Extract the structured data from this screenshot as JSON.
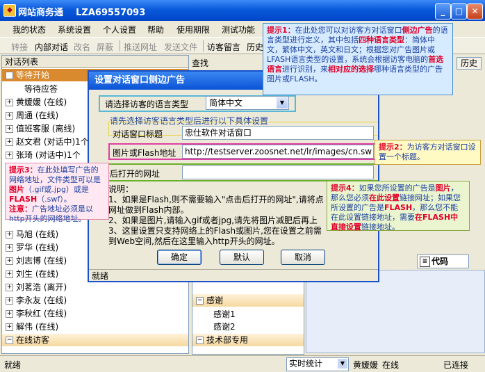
{
  "window": {
    "app_title": "网站商务通",
    "account_id": "LZA69557093"
  },
  "menu": [
    "我的状态",
    "系统设置",
    "个人设置",
    "帮助",
    "使用期限",
    "测试功能"
  ],
  "toolbar": {
    "items": [
      {
        "label": "转接",
        "enabled": false
      },
      {
        "label": "内部对话",
        "enabled": true
      },
      {
        "label": "改名",
        "enabled": false
      },
      {
        "label": "屏蔽",
        "enabled": false
      },
      {
        "label": "推送网址",
        "enabled": false
      },
      {
        "label": "发送文件",
        "enabled": false
      },
      {
        "label": "访客留言",
        "enabled": true
      },
      {
        "label": "历史",
        "enabled": true
      }
    ]
  },
  "left_panel": {
    "header": "对话列表",
    "items": [
      {
        "label": "等待开始",
        "kind": "group-selected",
        "prefix": "−"
      },
      {
        "label": "等待应答",
        "kind": "child"
      },
      {
        "label": "黄媛媛 (在线)",
        "kind": "row"
      },
      {
        "label": "周通 (在线)",
        "kind": "row"
      },
      {
        "label": "值班客服 (离线)",
        "kind": "row"
      },
      {
        "label": "赵文君 (对话中)1个",
        "kind": "row"
      },
      {
        "label": "张琦 (对话中)1个",
        "kind": "row"
      },
      {
        "label": "马旭 (在线)",
        "kind": "row"
      },
      {
        "label": "罗华 (在线)",
        "kind": "row"
      },
      {
        "label": "刘志博 (在线)",
        "kind": "row"
      },
      {
        "label": "刘生 (在线)",
        "kind": "row"
      },
      {
        "label": "刘茗浩 (离开)",
        "kind": "row"
      },
      {
        "label": "李永友 (在线)",
        "kind": "row"
      },
      {
        "label": "李秋红 (在线)",
        "kind": "row"
      },
      {
        "label": "解伟 (在线)",
        "kind": "row"
      },
      {
        "label": "在线访客",
        "kind": "group"
      }
    ]
  },
  "right_panel": {
    "search_label": "查找",
    "history_label": "历史",
    "code_label": "代码",
    "tree": [
      {
        "label": "感谢",
        "kind": "group"
      },
      {
        "label": "感谢1",
        "kind": "child"
      },
      {
        "label": "感谢2",
        "kind": "child"
      },
      {
        "label": "技术部专用",
        "kind": "group"
      }
    ]
  },
  "status_bar": {
    "left": "就绪",
    "select_value": "实时统计",
    "user": "黄媛媛",
    "user_state": "在线",
    "connection": "已连接"
  },
  "dialog": {
    "title": "设置对话窗口侧边广告",
    "language_label": "请选择访客的语言类型",
    "language_value": "简体中文",
    "group_caption": "请先选择访客语言类型后进行以下具体设置",
    "window_title_label": "对话窗口标题",
    "window_title_value": "忠仕软件对话窗口",
    "image_url_label": "图片或Flash地址",
    "image_url_value": "http://testserver.zoosnet.net/lr/images/cn.sw",
    "click_url_label": "点击后打开的网址",
    "click_url_value": "",
    "notes": [
      "说明：",
      "1、如果是Flash,则不需要输入\"点击后打开的网址\",请将点",
      "网址做到Flash内部。",
      "2、如果是图片,请输入gif或者jpg,请先将图片减肥后再上",
      "3、这里设置只支持网络上的Flash或图片,您在设置之前需",
      "到Web空间,然后在这里输入http开头的网址。"
    ],
    "ok_label": "确定",
    "default_label": "默认",
    "cancel_label": "取消",
    "status": "就绪"
  },
  "tips": {
    "tip1": {
      "head": "提示1：",
      "t1": "在此处您可以对访客方对话窗口",
      "h1": "侧边广告",
      "t2": "的语言类型进行定义，其中包括",
      "h2": "四种语言类型",
      "t3": "：简体中文，繁体中文，英文和日文；根据您对广告图片或LFASH语言类型的设置，系统会根据访客电脑的",
      "h3": "首选语言",
      "t4": "进行识别，来",
      "h4": "相对应的选择",
      "t5": "哪种语言类型的广告图片或FLASH。"
    },
    "tip2": {
      "head": "提示2：",
      "body": "为访客方对话窗口设置一个标题。"
    },
    "tip3": {
      "head": "提示3：",
      "t1": "在此处填写广告的网络地址，文件类型可以是",
      "h1": "图片",
      "t2": "（.gif或.jpg）或是",
      "h2": "FLASH",
      "t3": "（.swf）。",
      "note_head": "注意：",
      "note": "广告地址必须是以http开头的网络地址。"
    },
    "tip4": {
      "head": "提示4：",
      "t1": "如果您所设置的广告是",
      "h1": "图片",
      "t2": "，那么您必须",
      "h2": "在此设置",
      "t3": "链接网址；如果您所设置的广告是",
      "h3": "FLASH",
      "t4": "，那么您不能在此设置链接地址，需要",
      "h4": "在FLASH中直接设置",
      "t5": "链接地址。"
    }
  },
  "colors": {
    "title_blue": "#0a5adb",
    "highlight_red": "#e0002a",
    "tip_text_blue": "#1a3fa0",
    "group_selected": "#d98a2f"
  }
}
